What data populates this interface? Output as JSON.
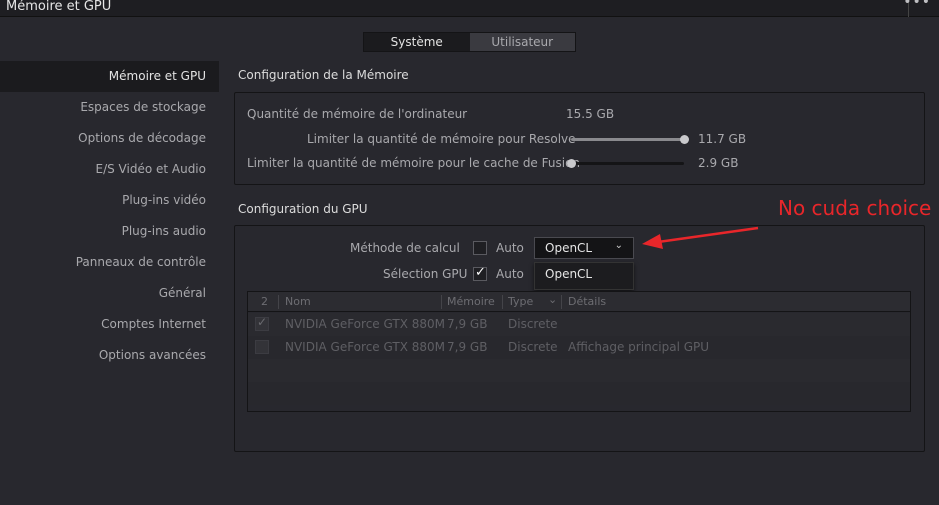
{
  "window": {
    "title": "Mémoire et GPU",
    "more_label": "•••"
  },
  "tabs": [
    {
      "label": "Système",
      "active": true
    },
    {
      "label": "Utilisateur",
      "active": false
    }
  ],
  "sidebar": {
    "items": [
      {
        "label": "Mémoire et GPU",
        "active": true
      },
      {
        "label": "Espaces de stockage"
      },
      {
        "label": "Options de décodage"
      },
      {
        "label": "E/S Vidéo et Audio"
      },
      {
        "label": "Plug-ins vidéo"
      },
      {
        "label": "Plug-ins audio"
      },
      {
        "label": "Panneaux de contrôle"
      },
      {
        "label": "Général"
      },
      {
        "label": "Comptes Internet"
      },
      {
        "label": "Options avancées"
      }
    ]
  },
  "memory": {
    "title": "Configuration de la Mémoire",
    "computer_memory_label": "Quantité de mémoire de l'ordinateur",
    "computer_memory_value": "15.5 GB",
    "resolve_limit_label": "Limiter la quantité de mémoire pour Resolve",
    "resolve_limit_value": "11.7 GB",
    "resolve_limit_fraction": 1.0,
    "fusion_limit_label": "Limiter la quantité de mémoire pour le cache de Fusion",
    "fusion_limit_value": "2.9 GB",
    "fusion_limit_fraction": 0.0
  },
  "gpu": {
    "title": "Configuration du GPU",
    "method_label": "Méthode de calcul",
    "method_auto_label": "Auto",
    "method_auto_checked": false,
    "method_selected": "OpenCL",
    "method_options": [
      "OpenCL"
    ],
    "selection_label": "Sélection GPU",
    "selection_auto_label": "Auto",
    "selection_auto_checked": true,
    "table": {
      "headers": [
        "2",
        "Nom",
        "Mémoire",
        "Type",
        "Détails"
      ],
      "rows": [
        {
          "checked": true,
          "name": "NVIDIA GeForce GTX 880M",
          "memory": "7,9 GB",
          "type": "Discrete",
          "details": ""
        },
        {
          "checked": false,
          "name": "NVIDIA GeForce GTX 880M",
          "memory": "7,9 GB",
          "type": "Discrete",
          "details": "Affichage principal GPU"
        }
      ]
    }
  },
  "annotation": {
    "text": "No cuda choice",
    "color": "#e8262a"
  },
  "colors": {
    "background": "#28282e",
    "panel_border": "#141416",
    "active_bg": "#1b1b1e"
  }
}
